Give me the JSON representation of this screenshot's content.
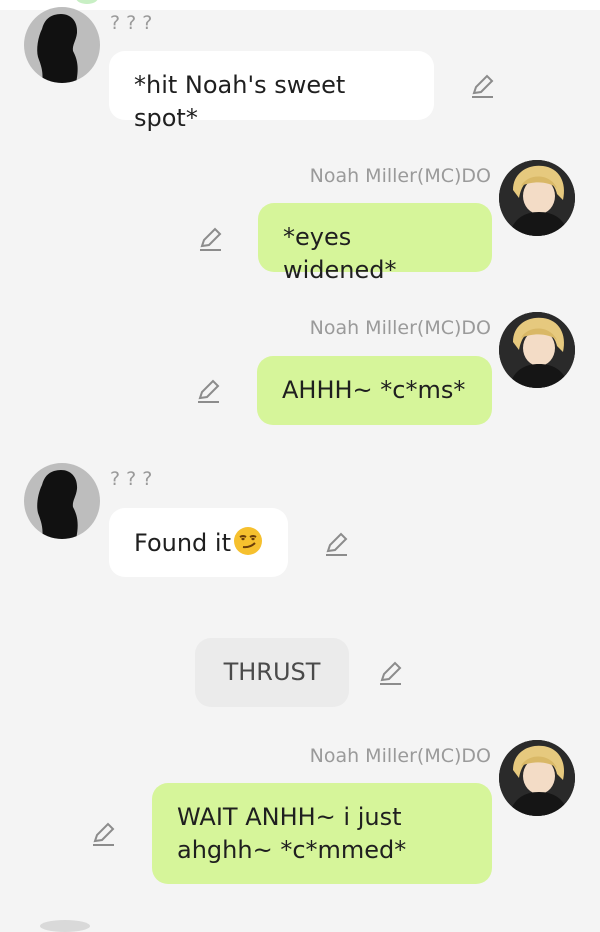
{
  "messages": [
    {
      "sender": "? ? ?",
      "text": "*hit Noah's sweet spot*"
    },
    {
      "sender": "Noah Miller(MC)DO",
      "text": "*eyes widened*"
    },
    {
      "sender": "Noah Miller(MC)DO",
      "text": "AHHH~ *c*ms*"
    },
    {
      "sender": "? ? ?",
      "text": "Found it"
    },
    {
      "narration": "THRUST"
    },
    {
      "sender": "Noah Miller(MC)DO",
      "text_line1": "WAIT ANHH~ i just",
      "text_line2": "ahghh~ *c*mmed*"
    }
  ],
  "colors": {
    "background": "#f4f4f4",
    "own_bubble": "#d6f59a",
    "other_bubble": "#ffffff",
    "narration_bubble": "#ebebeb"
  },
  "icons": {
    "edit": "pencil-icon",
    "emoji": "smirk-face-emoji"
  }
}
